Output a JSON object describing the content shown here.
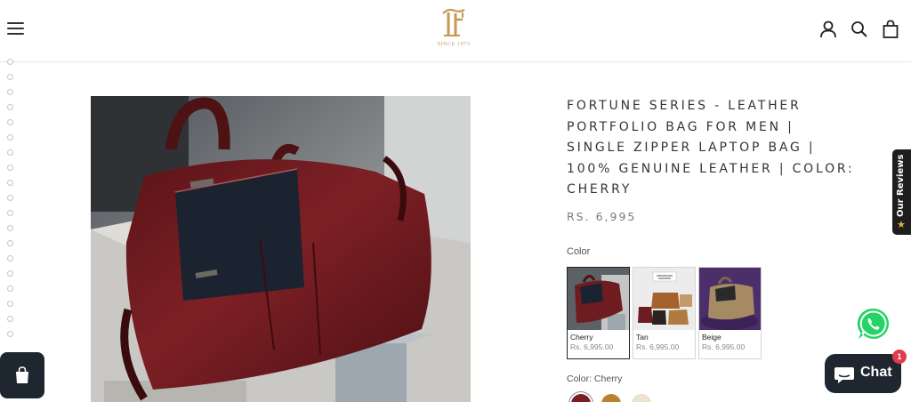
{
  "header": {
    "logo_text": "SINCE 1973",
    "menu_icon": "hamburger-menu-icon",
    "account_icon": "account-icon",
    "search_icon": "search-icon",
    "cart_icon": "shopping-bag-icon"
  },
  "product": {
    "title": "FORTUNE SERIES - LEATHER PORTFOLIO BAG FOR MEN | SINGLE ZIPPER LAPTOP BAG | 100% GENUINE LEATHER | COLOR: CHERRY",
    "price": "RS. 6,995",
    "color_label": "Color",
    "selected_color_text": "Color: Cherry",
    "variants": [
      {
        "name": "Cherry",
        "price": "Rs. 6,995.00",
        "selected": true
      },
      {
        "name": "Tan",
        "price": "Rs. 6,995.00",
        "selected": false
      },
      {
        "name": "Beige",
        "price": "Rs. 6,995.00",
        "selected": false
      }
    ],
    "swatch_colors": [
      "#7a1e22",
      "#b98232",
      "#eee3cc"
    ],
    "thumbnail_count": 19
  },
  "widgets": {
    "reviews_tab": "Our Reviews",
    "chat_label": "Chat",
    "chat_badge": "1",
    "whatsapp_icon": "whatsapp-icon",
    "shop_icon": "shop-bag-icon"
  },
  "colors": {
    "brand_gold": "#c49a50",
    "dark_widget": "#1e2730",
    "whatsapp_green": "#25d366",
    "badge_red": "#e2394b"
  }
}
